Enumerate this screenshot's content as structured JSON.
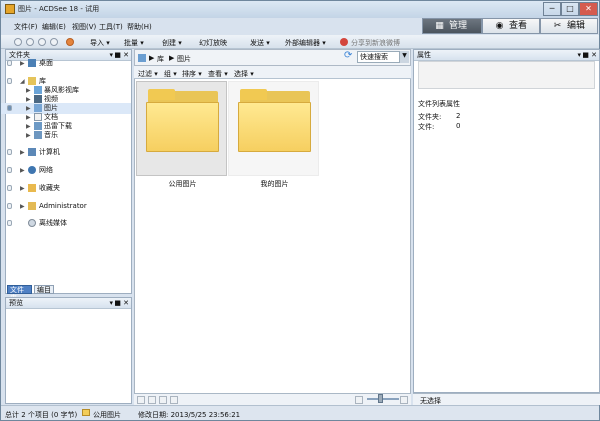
{
  "window": {
    "title": "图片 - ACDSee 18 - 试用",
    "controls": [
      "─",
      "□",
      "✕"
    ]
  },
  "menu": [
    "文件(F)",
    "编辑(E)",
    "视图(V)",
    "工具(T)",
    "帮助(H)"
  ],
  "modes": [
    {
      "label": "管理",
      "icon": "▦"
    },
    {
      "label": "查看",
      "icon": "◉"
    },
    {
      "label": "编辑",
      "icon": "✂"
    }
  ],
  "toolbar": {
    "items": [
      "导入 ▾",
      "批量 ▾",
      "创建 ▾",
      "幻灯放映",
      "发送 ▾",
      "外部编辑器 ▾"
    ],
    "share": "分享到新浪微博"
  },
  "folders_pane": {
    "title": "文件夹",
    "controls": [
      "▾",
      "■",
      "✕"
    ],
    "items": [
      {
        "label": "桌面",
        "icon": "desktop-icon"
      },
      {
        "label": "库",
        "icon": "library-icon"
      },
      {
        "label": "暴风影视库",
        "icon": "media-library-icon"
      },
      {
        "label": "视频",
        "icon": "video-icon"
      },
      {
        "label": "图片",
        "icon": "pictures-icon"
      },
      {
        "label": "文档",
        "icon": "documents-icon"
      },
      {
        "label": "迅雷下载",
        "icon": "download-icon"
      },
      {
        "label": "音乐",
        "icon": "music-icon"
      },
      {
        "label": "计算机",
        "icon": "computer-icon"
      },
      {
        "label": "网络",
        "icon": "network-icon"
      },
      {
        "label": "收藏夹",
        "icon": "favorites-icon"
      },
      {
        "label": "Administrator",
        "icon": "user-folder-icon"
      },
      {
        "label": "离线媒体",
        "icon": "offline-media-icon"
      }
    ],
    "tabs": [
      "文件夹",
      "编目"
    ]
  },
  "preview_pane": {
    "title": "预览",
    "controls": [
      "▾",
      "■",
      "✕"
    ]
  },
  "breadcrumb": [
    "库",
    "图片"
  ],
  "search": {
    "placeholder": "快速搜索"
  },
  "browser_tools": [
    "过滤 ▾",
    "组 ▾",
    "排序 ▾",
    "查看 ▾",
    "选择 ▾"
  ],
  "files": [
    {
      "name": "公用图片"
    },
    {
      "name": "我的图片"
    }
  ],
  "properties": {
    "title": "属性",
    "controls": [
      "▾",
      "■",
      "✕"
    ],
    "list_title": "文件列表属性",
    "rows": [
      {
        "label": "文件夹:",
        "value": "2"
      },
      {
        "label": "文件:",
        "value": "0"
      }
    ],
    "no_selection": "无选择"
  },
  "status": {
    "summary": "总计 2 个项目 (0 字节)",
    "folder": "公用图片",
    "modified": "修改日期: 2013/5/25 23:56:21"
  },
  "colors": {
    "selected": "#dbe8f8",
    "folder": "#f6cf60",
    "active_mode": "#4b545d"
  }
}
